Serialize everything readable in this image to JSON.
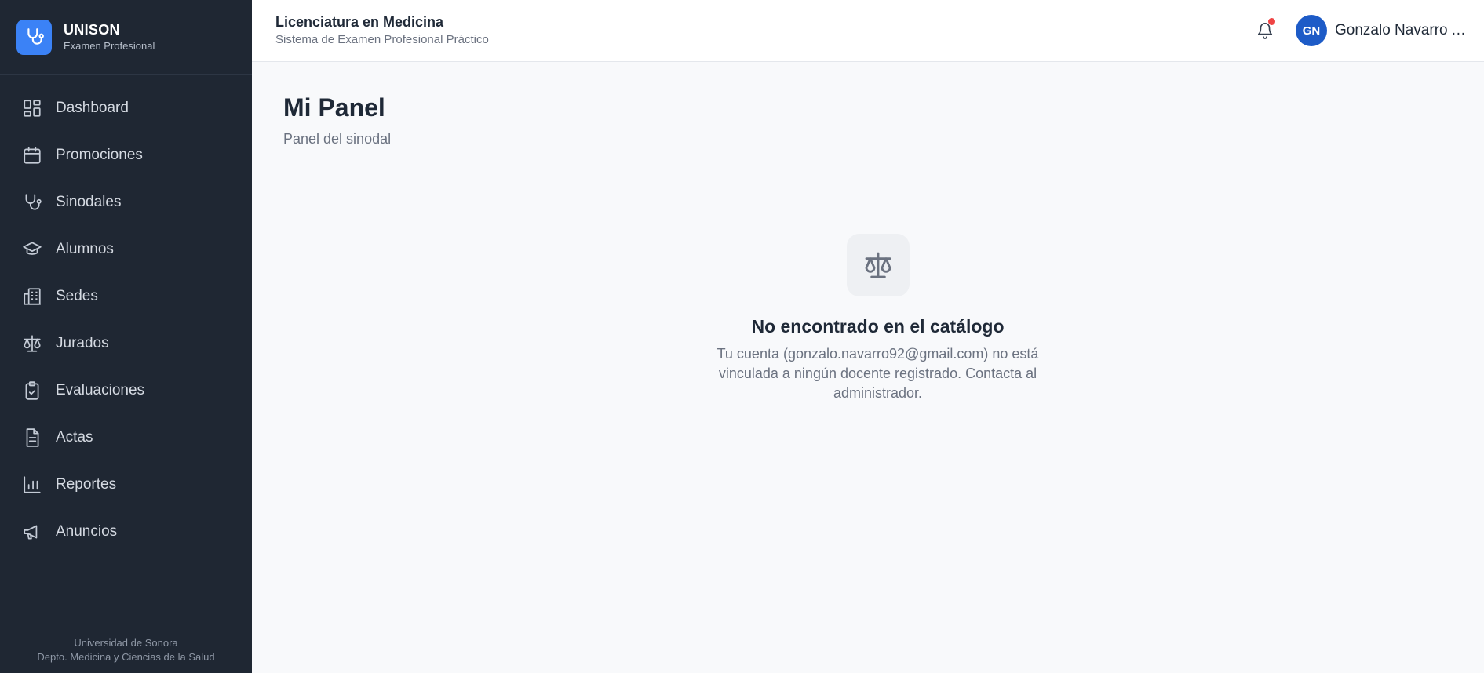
{
  "brand": {
    "title": "UNISON",
    "subtitle": "Examen Profesional",
    "logo_icon": "stethoscope-icon",
    "accent": "#3b82f6"
  },
  "sidebar": {
    "items": [
      {
        "label": "Dashboard",
        "icon": "dashboard-icon"
      },
      {
        "label": "Promociones",
        "icon": "calendar-icon"
      },
      {
        "label": "Sinodales",
        "icon": "stethoscope-icon"
      },
      {
        "label": "Alumnos",
        "icon": "graduation-cap-icon"
      },
      {
        "label": "Sedes",
        "icon": "building-icon"
      },
      {
        "label": "Jurados",
        "icon": "scale-icon"
      },
      {
        "label": "Evaluaciones",
        "icon": "clipboard-check-icon"
      },
      {
        "label": "Actas",
        "icon": "document-icon"
      },
      {
        "label": "Reportes",
        "icon": "bar-chart-icon"
      },
      {
        "label": "Anuncios",
        "icon": "megaphone-icon"
      }
    ],
    "footer_line1": "Universidad de Sonora",
    "footer_line2": "Depto. Medicina y Ciencias de la Salud"
  },
  "header": {
    "title": "Licenciatura en Medicina",
    "subtitle": "Sistema de Examen Profesional Práctico",
    "notification_icon": "bell-icon",
    "notification_dot_color": "#ef4444",
    "user_initials": "GN",
    "user_name": "Gonzalo Navarro A..."
  },
  "main": {
    "title": "Mi Panel",
    "subtitle": "Panel del sinodal",
    "empty_state": {
      "icon": "scale-icon",
      "title": "No encontrado en el catálogo",
      "message": "Tu cuenta (gonzalo.navarro92@gmail.com) no está vinculada a ningún docente registrado. Contacta al administrador."
    }
  }
}
